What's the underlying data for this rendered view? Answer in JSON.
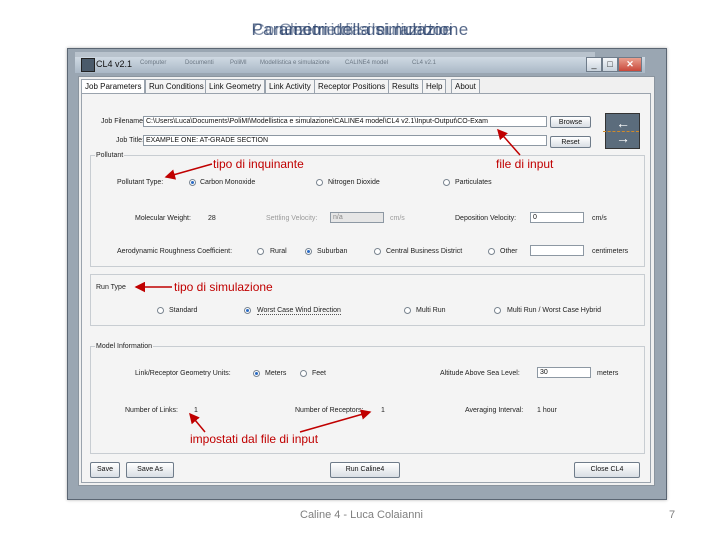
{
  "slide": {
    "title_layers": [
      "Parametri della simulazione",
      "Condizioni di simulazione",
      "Geometria dei ricettori"
    ],
    "footer": "Caline 4 - Luca Colaianni",
    "page_number": "7",
    "annotations": [
      "tipo di inquinante",
      "file di input",
      "tipo di simulazione",
      "impostati dal file di input"
    ],
    "annotation_color": "#c00000"
  },
  "window": {
    "title": "CL4 v2.1",
    "breadcrumb": [
      "Computer",
      "Documenti",
      "PoliMI",
      "Modellistica e simulazione",
      "CALINE4 model",
      "CL4 v2.1"
    ],
    "buttons": [
      "_",
      "□",
      "✕"
    ],
    "tabs": [
      "Job Parameters",
      "Run Conditions",
      "Link Geometry",
      "Link Activity",
      "Receptor Positions",
      "Results",
      "Help",
      "About"
    ]
  },
  "job": {
    "filename_label": "Job Filename:",
    "filename_value": "C:\\Users\\Luca\\Documents\\PoliMI\\Modellistica e simulazione\\CALINE4 model\\CL4 v2.1\\Input-Output\\CO-Exam",
    "browse": "Browse",
    "title_label": "Job Title:",
    "title_value": "EXAMPLE ONE: AT-GRADE SECTION",
    "reset": "Reset"
  },
  "pollutant": {
    "group": "Pollutant",
    "type_label": "Pollutant Type:",
    "options": [
      "Carbon Monoxide",
      "Nitrogen Dioxide",
      "Particulates"
    ],
    "selected": 0,
    "mw_label": "Molecular Weight:",
    "mw_value": "28",
    "settling_label": "Settling Velocity:",
    "settling_value": "n/a",
    "settling_unit": "cm/s",
    "deposition_label": "Deposition Velocity:",
    "deposition_value": "0",
    "deposition_unit": "cm/s",
    "roughness_label": "Aerodynamic Roughness Coefficient:",
    "roughness_options": [
      "Rural",
      "Suburban",
      "Central Business District",
      "Other"
    ],
    "roughness_selected": 1,
    "roughness_unit": "centimeters"
  },
  "run_type": {
    "group": "Run Type",
    "options": [
      "Standard",
      "Worst Case Wind Direction",
      "Multi Run",
      "Multi Run / Worst Case Hybrid"
    ],
    "selected": 1
  },
  "model": {
    "group": "Model Information",
    "units_label": "Link/Receptor Geometry Units:",
    "units_options": [
      "Meters",
      "Feet"
    ],
    "units_selected": 0,
    "altitude_label": "Altitude Above Sea Level:",
    "altitude_value": "30",
    "altitude_unit": "meters",
    "links_label": "Number of Links:",
    "links_value": "1",
    "receptors_label": "Number of Receptors:",
    "receptors_value": "1",
    "averaging_label": "Averaging Interval:",
    "averaging_value": "1 hour"
  },
  "actions": [
    "Save",
    "Save As",
    "Run Caline4",
    "Close CL4"
  ]
}
